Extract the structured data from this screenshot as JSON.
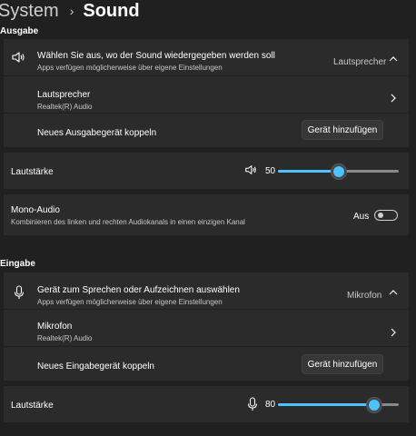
{
  "breadcrumb": {
    "parent": "System",
    "separator": "›",
    "current": "Sound"
  },
  "output": {
    "section_title": "Ausgabe",
    "choose": {
      "title": "Wählen Sie aus, wo der Sound wiedergegeben werden soll",
      "subtitle": "Apps verfügen möglicherweise über eigene Einstellungen",
      "selected": "Lautsprecher",
      "icon": "speaker-icon"
    },
    "device": {
      "name": "Lautsprecher",
      "detail": "Realtek(R) Audio"
    },
    "pair": {
      "label": "Neues Ausgabegerät koppeln",
      "button": "Gerät hinzufügen"
    },
    "volume": {
      "label": "Lautstärke",
      "value": "50",
      "level": 50
    },
    "mono": {
      "title": "Mono-Audio",
      "subtitle": "Kombinieren des linken und rechten Audiokanals in einen einzigen Kanal",
      "state": "Aus"
    }
  },
  "input": {
    "section_title": "Eingabe",
    "choose": {
      "title": "Gerät zum Sprechen oder Aufzeichnen auswählen",
      "subtitle": "Apps verfügen möglicherweise über eigene Einstellungen",
      "selected": "Mikrofon",
      "icon": "microphone-icon"
    },
    "device": {
      "name": "Mikrofon",
      "detail": "Realtek(R) Audio"
    },
    "pair": {
      "label": "Neues Eingabegerät koppeln",
      "button": "Gerät hinzufügen"
    },
    "volume": {
      "label": "Lautstärke",
      "value": "80",
      "level": 80
    }
  },
  "colors": {
    "accent": "#4cc2ff",
    "background": "#202020",
    "card": "#2b2b2b"
  }
}
